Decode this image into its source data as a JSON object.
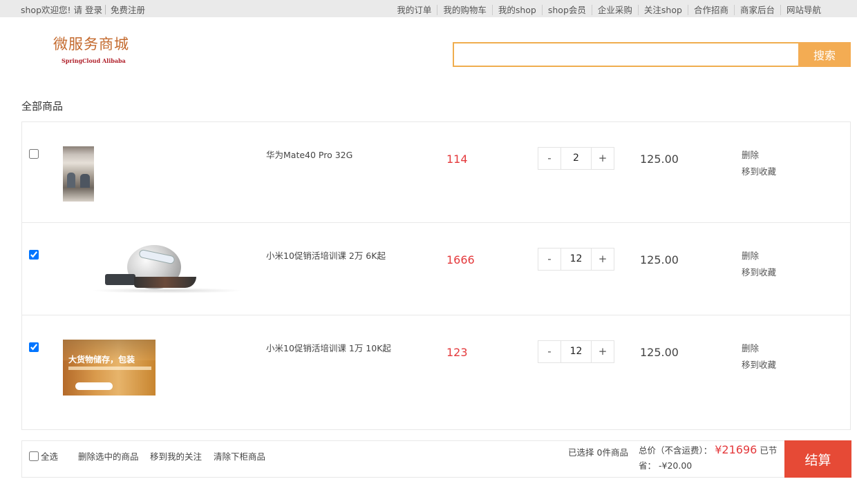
{
  "topbar": {
    "welcome": "shop欢迎您!",
    "login_prefix": "请",
    "login": "登录",
    "register": "免费注册",
    "links": [
      "我的订单",
      "我的购物车",
      "我的shop",
      "shop会员",
      "企业采购",
      "关注shop",
      "合作招商",
      "商家后台",
      "网站导航"
    ]
  },
  "logo": {
    "title": "微服务商城",
    "subtitle": "SpringCloud Alibaba"
  },
  "search": {
    "value": "",
    "button_label": "搜索"
  },
  "section_title": "全部商品",
  "items": [
    {
      "checked": false,
      "name": "华为Mate40 Pro 32G",
      "price": "114",
      "qty": "2",
      "subtotal": "125.00",
      "delete": "删除",
      "favorite": "移到收藏",
      "thumb_icon": "book-cover-image"
    },
    {
      "checked": true,
      "name": "小米10促销活培训课 2万 6K起",
      "price": "1666",
      "qty": "12",
      "subtotal": "125.00",
      "delete": "删除",
      "favorite": "移到收藏",
      "thumb_icon": "logistics-globe-image"
    },
    {
      "checked": true,
      "name": "小米10促销活培训课 1万 10K起",
      "price": "123",
      "qty": "12",
      "subtotal": "125.00",
      "delete": "删除",
      "favorite": "移到收藏",
      "thumb_icon": "warehouse-banner-image",
      "thumb_text": "大货物储存，包装"
    }
  ],
  "qty_controls": {
    "minus": "-",
    "plus": "+"
  },
  "bottombar": {
    "select_all": "全选",
    "delete_selected": "删除选中的商品",
    "move_to_follow": "移到我的关注",
    "clear_offshelf": "清除下柜商品",
    "selected_prefix": "已选择",
    "selected_count": "0",
    "selected_suffix": "件商品",
    "total_label": "总价（不含运费）：",
    "total_amount": "¥21696",
    "saved_label": "已节省：",
    "saved_amount": "-¥20.00",
    "checkout": "结算"
  },
  "colors": {
    "price_red": "#e4393c",
    "search_orange": "#f3ac53",
    "checkout_red": "#e64a36"
  }
}
